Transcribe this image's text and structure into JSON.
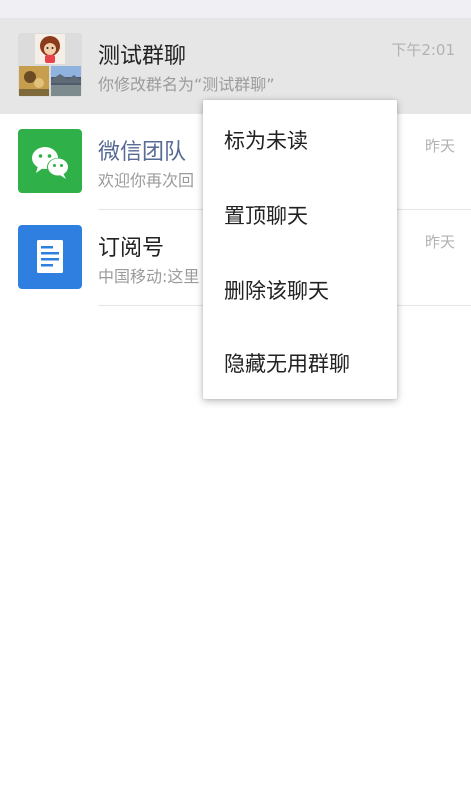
{
  "chats": [
    {
      "name": "测试群聊",
      "preview": "你修改群名为“测试群聊”",
      "time": "下午2:01",
      "avatar": "group-avatar-icon"
    },
    {
      "name": "微信团队",
      "preview": "欢迎你再次回",
      "time": "昨天",
      "avatar": "wechat-team-icon",
      "avatar_color": "#2fb048"
    },
    {
      "name": "订阅号",
      "preview": "中国移动:这里",
      "time": "昨天",
      "avatar": "subscription-icon",
      "avatar_color": "#2f7fe0"
    }
  ],
  "context_menu": {
    "items": [
      {
        "label": "标为未读"
      },
      {
        "label": "置顶聊天"
      },
      {
        "label": "删除该聊天"
      },
      {
        "label": "隐藏无用群聊"
      }
    ]
  },
  "colors": {
    "official_name": "#576b95",
    "pressed_row": "#e6e6e6",
    "secondary_text": "#9b9b9b"
  }
}
